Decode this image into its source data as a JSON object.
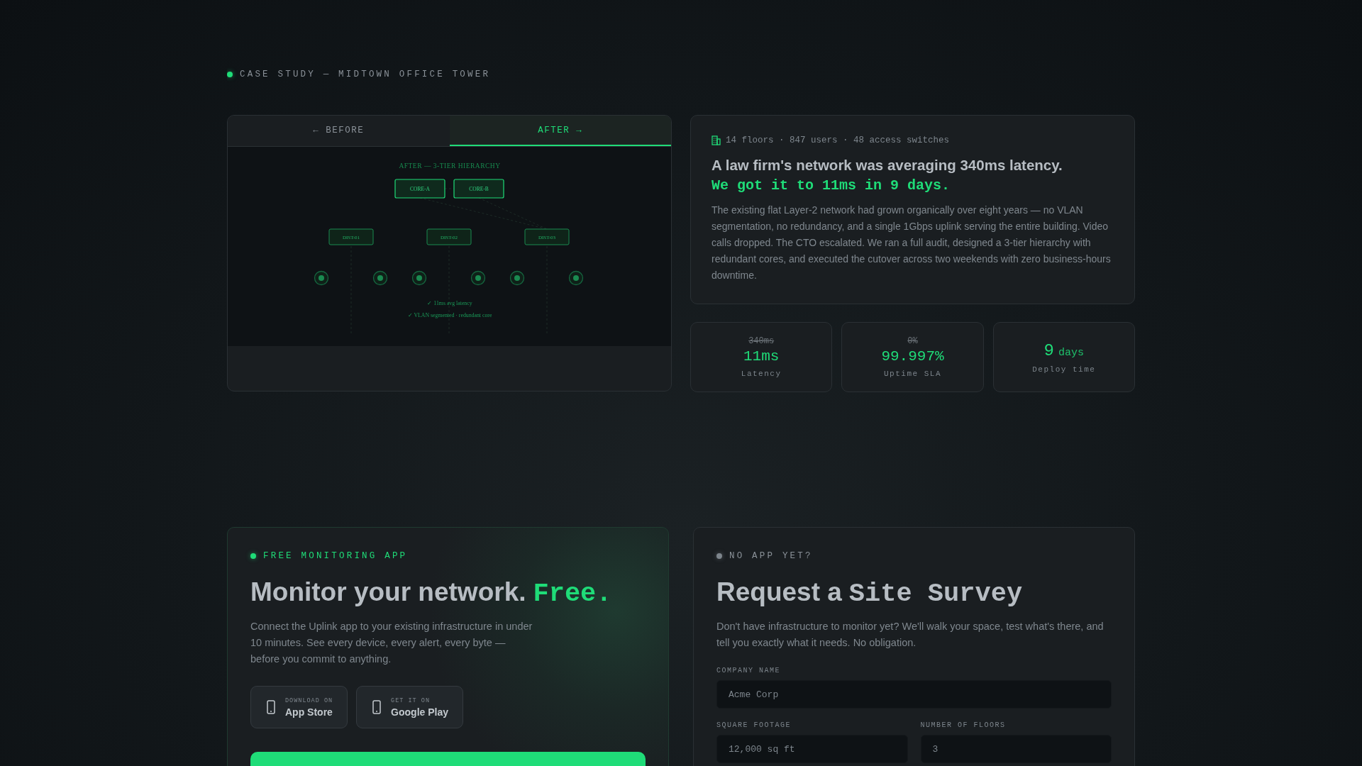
{
  "eyebrow": {
    "text": "CASE STUDY — MIDTOWN OFFICE TOWER"
  },
  "tabs": [
    {
      "label": "← BEFORE",
      "selected": false
    },
    {
      "label": "AFTER →",
      "selected": true
    }
  ],
  "diagram": {
    "title": "AFTER — 3-TIER HIERARCHY",
    "core": [
      "CORE-A",
      "CORE-B"
    ],
    "distribution": [
      "DIST-01",
      "DIST-02",
      "DIST-03"
    ],
    "checks": [
      "✓ 11ms avg latency",
      "✓ VLAN segmented · redundant core"
    ]
  },
  "case": {
    "meta": "14 floors · 847 users · 48 access switches",
    "headline": "A law firm's network was averaging 340ms latency.",
    "result": "We got it to 11ms in 9 days.",
    "body": "The existing flat Layer-2 network had grown organically over eight years — no VLAN segmentation, no redundancy, and a single 1Gbps uplink serving the entire building. Video calls dropped. The CTO escalated. We ran a full audit, designed a 3-tier hierarchy with redundant cores, and executed the cutover across two weekends with zero business-hours downtime."
  },
  "stats": [
    {
      "kind": "compare",
      "was": "340ms",
      "value": "11ms",
      "label": "Latency"
    },
    {
      "kind": "compare",
      "was": "0%",
      "value": "99.997%",
      "label": "Uptime SLA"
    },
    {
      "kind": "unit",
      "value": "9",
      "unit": "days",
      "label": "Deploy time"
    }
  ],
  "app": {
    "eyebrow": "FREE MONITORING APP",
    "title": "Monitor your network.",
    "accent": "Free.",
    "body": "Connect the Uplink app to your existing infrastructure in under 10 minutes. See every device, every alert, every byte — before you commit to anything.",
    "stores": [
      {
        "small": "DOWNLOAD ON",
        "name": "App Store"
      },
      {
        "small": "GET IT ON",
        "name": "Google Play"
      }
    ]
  },
  "survey": {
    "eyebrow": "NO APP YET?",
    "title": "Request a",
    "accent": "Site Survey",
    "body": "Don't have infrastructure to monitor yet? We'll walk your space, test what's there, and tell you exactly what it needs. No obligation.",
    "fields": [
      {
        "label": "COMPANY NAME",
        "placeholder": "Acme Corp"
      },
      {
        "label": "SQUARE FOOTAGE",
        "placeholder": "12,000 sq ft"
      },
      {
        "label": "NUMBER OF FLOORS",
        "placeholder": "3"
      }
    ]
  }
}
